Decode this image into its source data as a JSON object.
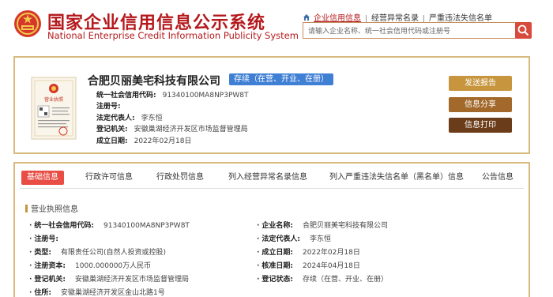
{
  "header": {
    "title_cn": "国家企业信用信息公示系统",
    "title_en": "National Enterprise Credit Information Publicity System",
    "links": [
      "企业信用信息",
      "经营异常名录",
      "严重违法失信名单"
    ],
    "search_placeholder": "请输入企业名称、统一社会信用代码或注册号"
  },
  "company": {
    "name": "合肥贝丽美宅科技有限公司",
    "status": "存续（在营、开业、在册）",
    "fields": [
      {
        "label": "统一社会信用代码:",
        "value": "91340100MA8NP3PW8T"
      },
      {
        "label": "注册号:",
        "value": ""
      },
      {
        "label": "法定代表人:",
        "value": "李东恒"
      },
      {
        "label": "登记机关:",
        "value": "安徽巢湖经济开发区市场监督管理局"
      },
      {
        "label": "成立日期:",
        "value": "2022年02月18日"
      }
    ],
    "license_label": "营业执照",
    "buttons": {
      "report": "发送报告",
      "share": "信息分享",
      "print": "信息打印"
    }
  },
  "tabs": [
    "基础信息",
    "行政许可信息",
    "行政处罚信息",
    "列入经营异常名录信息",
    "列入严重违法失信名单（黑名单）信息",
    "公告信息"
  ],
  "section_title": "营业执照信息",
  "details_left": [
    {
      "label": "统一社会信用代码:",
      "value": "91340100MA8NP3PW8T"
    },
    {
      "label": "注册号:",
      "value": ""
    },
    {
      "label": "类型:",
      "value": "有限责任公司(自然人投资或控股)"
    },
    {
      "label": "注册资本:",
      "value": "1000.000000万人民币"
    },
    {
      "label": "登记机关:",
      "value": "安徽巢湖经济开发区市场监督管理局"
    },
    {
      "label": "住所:",
      "value": "安徽巢湖经济开发区金山北路1号"
    }
  ],
  "details_right": [
    {
      "label": "企业名称:",
      "value": "合肥贝丽美宅科技有限公司"
    },
    {
      "label": "法定代表人:",
      "value": "李东恒"
    },
    {
      "label": "成立日期:",
      "value": "2022年02月18日"
    },
    {
      "label": "核准日期:",
      "value": "2024年04月18日"
    },
    {
      "label": "登记状态:",
      "value": "存续（在营、开业、在册）"
    }
  ]
}
